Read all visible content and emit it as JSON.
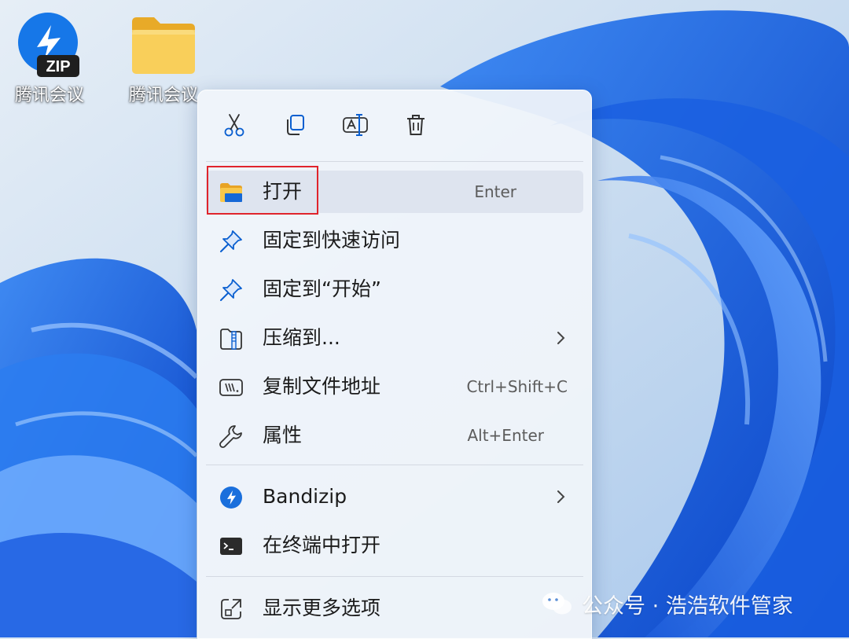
{
  "desktop": {
    "icons": [
      {
        "label": "腾讯会议",
        "badge": "ZIP"
      },
      {
        "label": "腾讯会议"
      }
    ]
  },
  "context_menu": {
    "toolbar": [
      "cut-icon",
      "copy-icon",
      "rename-icon",
      "delete-icon"
    ],
    "items": [
      {
        "label": "打开",
        "shortcut": "Enter",
        "icon": "folder-icon"
      },
      {
        "label": "固定到快速访问",
        "icon": "pin-icon"
      },
      {
        "label": "固定到“开始”",
        "icon": "pin-icon"
      },
      {
        "label": "压缩到...",
        "icon": "zip-folder-icon",
        "submenu": true
      },
      {
        "label": "复制文件地址",
        "shortcut": "Ctrl+Shift+C",
        "icon": "copy-path-icon"
      },
      {
        "label": "属性",
        "shortcut": "Alt+Enter",
        "icon": "wrench-icon"
      },
      {
        "label": "Bandizip",
        "icon": "bandizip-icon",
        "submenu": true
      },
      {
        "label": "在终端中打开",
        "icon": "terminal-icon"
      },
      {
        "label": "显示更多选项",
        "icon": "more-options-icon"
      }
    ]
  },
  "watermark": {
    "text": "公众号 · 浩浩软件管家"
  },
  "colors": {
    "accent": "#0a5fd0",
    "highlight_box": "#e0242c",
    "folder": "#f5c34a"
  }
}
